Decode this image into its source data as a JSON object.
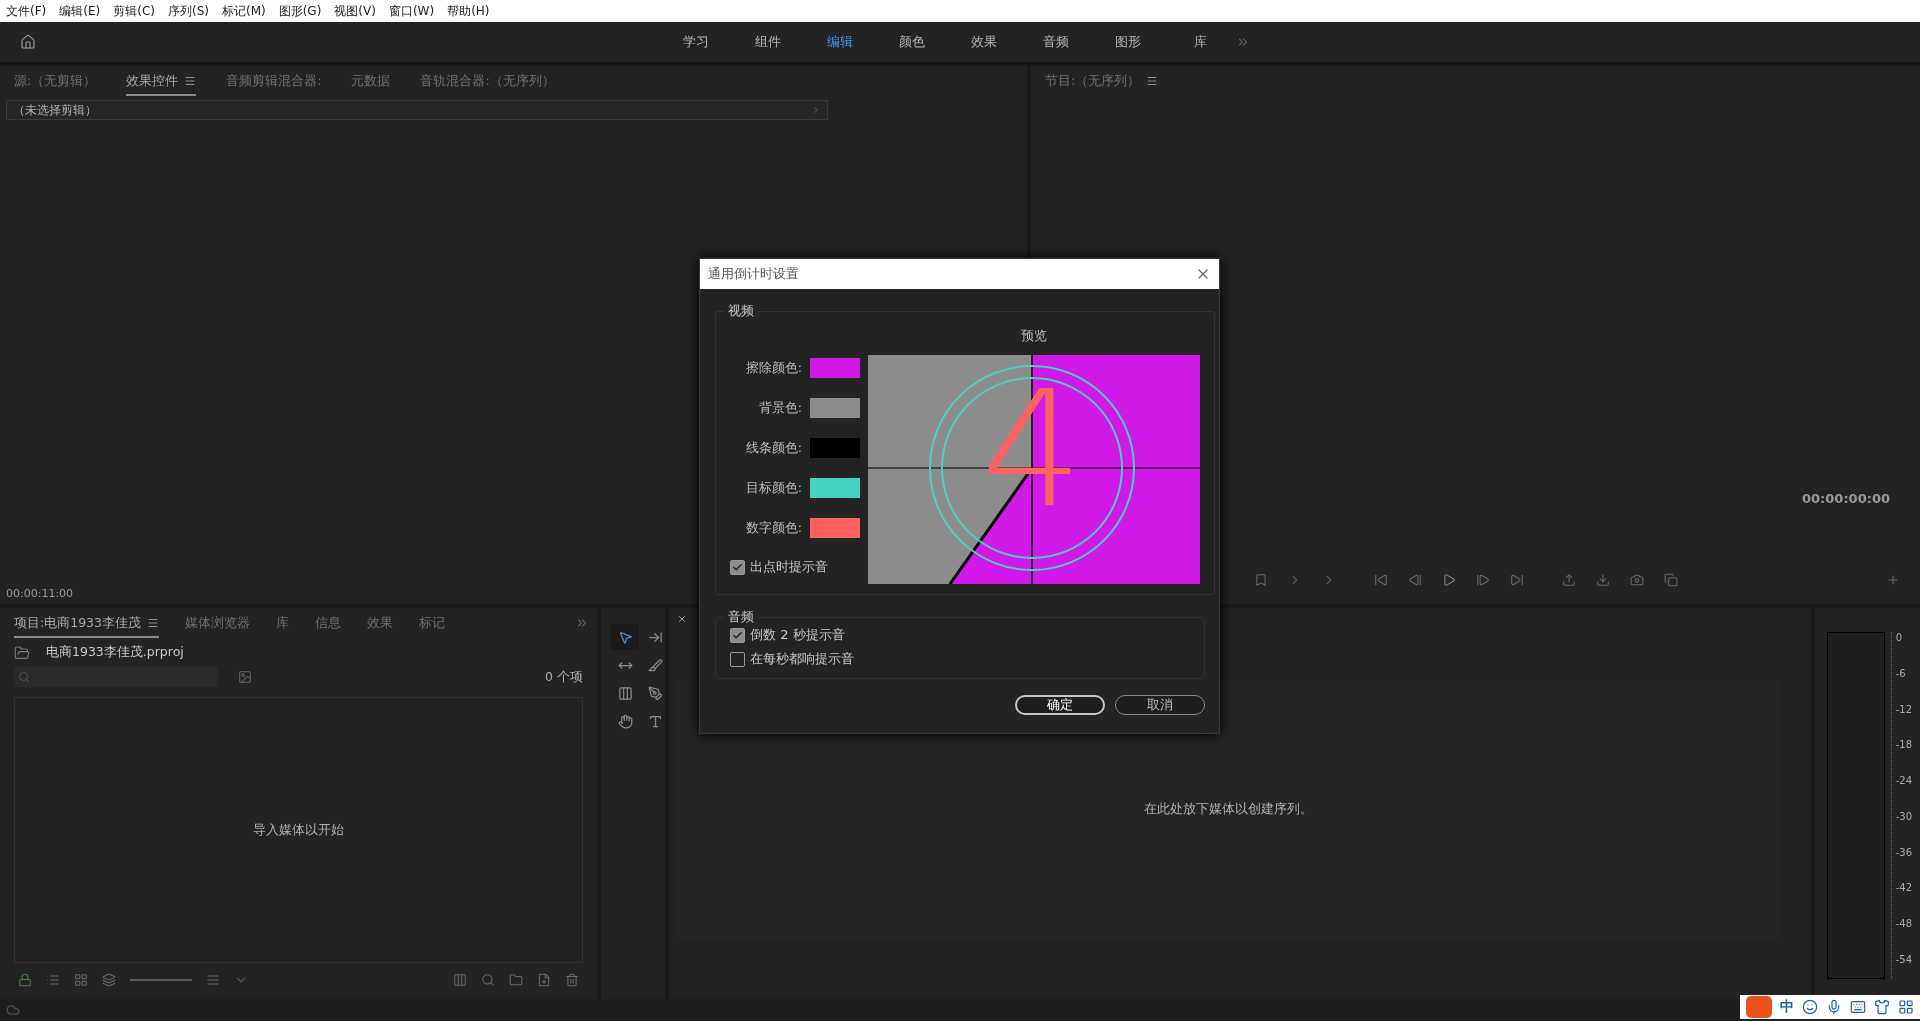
{
  "menu_bar": [
    "文件(F)",
    "编辑(E)",
    "剪辑(C)",
    "序列(S)",
    "标记(M)",
    "图形(G)",
    "视图(V)",
    "窗口(W)",
    "帮助(H)"
  ],
  "workspaces": [
    {
      "label": "学习",
      "selected": false
    },
    {
      "label": "组件",
      "selected": false
    },
    {
      "label": "编辑",
      "selected": true
    },
    {
      "label": "颜色",
      "selected": false
    },
    {
      "label": "效果",
      "selected": false
    },
    {
      "label": "音频",
      "selected": false
    },
    {
      "label": "图形",
      "selected": false
    },
    {
      "label": "库",
      "selected": false
    }
  ],
  "source_panel": {
    "tabs": [
      {
        "label": "源:（无剪辑）",
        "selected": false
      },
      {
        "label": "效果控件",
        "selected": true
      },
      {
        "label": "音频剪辑混合器:",
        "selected": false
      },
      {
        "label": "元数据",
        "selected": false
      },
      {
        "label": "音轨混合器:（无序列）",
        "selected": false
      }
    ],
    "clip_header": "（未选择剪辑）",
    "timecode": "00:00:11:00"
  },
  "program_panel": {
    "tab": "节目:（无序列）",
    "timecode": "00:00:00:00"
  },
  "project_panel": {
    "tabs": [
      {
        "label": "项目:电商1933李佳茂",
        "selected": true
      },
      {
        "label": "媒体浏览器",
        "selected": false
      },
      {
        "label": "库",
        "selected": false
      },
      {
        "label": "信息",
        "selected": false
      },
      {
        "label": "效果",
        "selected": false
      },
      {
        "label": "标记",
        "selected": false
      }
    ],
    "file": "电商1933李佳茂.prproj",
    "item_count": "0 个项",
    "empty_message": "导入媒体以开始"
  },
  "tools": [
    {
      "kind": "select",
      "selected": true
    },
    {
      "kind": "track",
      "selected": false
    },
    {
      "kind": "ripple",
      "selected": false
    },
    {
      "kind": "razor",
      "selected": false
    },
    {
      "kind": "slip",
      "selected": false
    },
    {
      "kind": "pen",
      "selected": false
    },
    {
      "kind": "hand",
      "selected": false
    },
    {
      "kind": "type",
      "selected": false
    }
  ],
  "timeline": {
    "empty_message": "在此处放下媒体以创建序列。"
  },
  "audio_meter": {
    "scale": [
      "0",
      "-6",
      "-12",
      "-18",
      "-24",
      "-30",
      "-36",
      "-42",
      "-48",
      "-54"
    ]
  },
  "ime_bar": {
    "mode": "中"
  },
  "dialog": {
    "title": "通用倒计时设置",
    "video": {
      "legend": "视频",
      "preview_label": "预览",
      "digit": "4",
      "colors": [
        {
          "label": "擦除颜色:",
          "color": "#d21ae8"
        },
        {
          "label": "背景色:",
          "color": "#8c8c8c"
        },
        {
          "label": "线条颜色:",
          "color": "#000000"
        },
        {
          "label": "目标颜色:",
          "color": "#48d1c0"
        },
        {
          "label": "数字颜色:",
          "color": "#ff6161"
        }
      ],
      "cue_at_out": {
        "label": "出点时提示音",
        "checked": true
      }
    },
    "audio": {
      "legend": "音频",
      "options": [
        {
          "label": "倒数 2 秒提示音",
          "checked": true
        },
        {
          "label": "在每秒都响提示音",
          "checked": false
        }
      ]
    },
    "buttons": [
      {
        "label": "确定",
        "kind": "primary"
      },
      {
        "label": "取消",
        "kind": "secondary"
      }
    ]
  }
}
